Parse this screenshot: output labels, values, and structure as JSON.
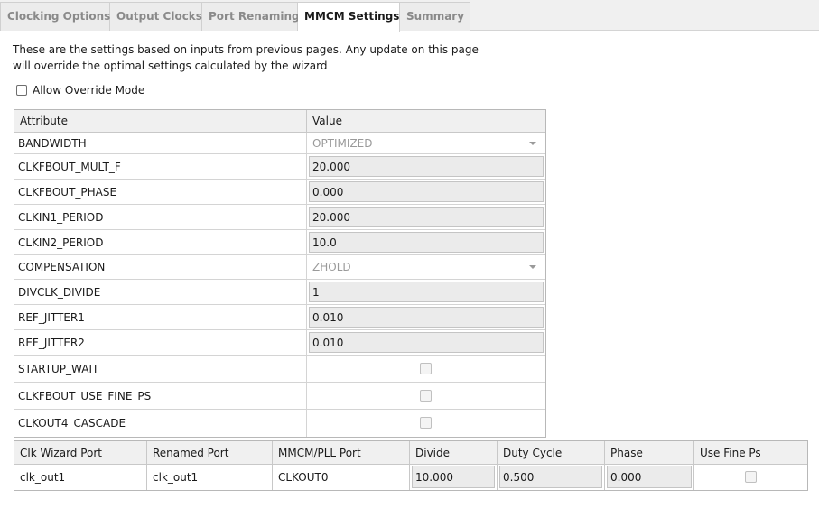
{
  "tabs": [
    {
      "label": "Clocking Options",
      "active": false
    },
    {
      "label": "Output Clocks",
      "active": false
    },
    {
      "label": "Port Renaming",
      "active": false
    },
    {
      "label": "MMCM Settings",
      "active": true
    },
    {
      "label": "Summary",
      "active": false
    }
  ],
  "description": {
    "line1": "These are the settings based on inputs from previous pages. Any update on this page",
    "line2": "will override the optimal settings calculated by the wizard"
  },
  "override": {
    "label": "Allow Override Mode",
    "checked": false
  },
  "attributes": {
    "header_attribute": "Attribute",
    "header_value": "Value",
    "rows": [
      {
        "name": "BANDWIDTH",
        "kind": "combo",
        "value": "OPTIMIZED"
      },
      {
        "name": "CLKFBOUT_MULT_F",
        "kind": "field",
        "value": "20.000"
      },
      {
        "name": "CLKFBOUT_PHASE",
        "kind": "field",
        "value": "0.000"
      },
      {
        "name": "CLKIN1_PERIOD",
        "kind": "field",
        "value": "20.000"
      },
      {
        "name": "CLKIN2_PERIOD",
        "kind": "field",
        "value": "10.0"
      },
      {
        "name": "COMPENSATION",
        "kind": "combo",
        "value": "ZHOLD"
      },
      {
        "name": "DIVCLK_DIVIDE",
        "kind": "field",
        "value": "1"
      },
      {
        "name": "REF_JITTER1",
        "kind": "field",
        "value": "0.010"
      },
      {
        "name": "REF_JITTER2",
        "kind": "field",
        "value": "0.010"
      },
      {
        "name": "STARTUP_WAIT",
        "kind": "checkbox",
        "value": false
      },
      {
        "name": "CLKFBOUT_USE_FINE_PS",
        "kind": "checkbox",
        "value": false
      },
      {
        "name": "CLKOUT4_CASCADE",
        "kind": "checkbox",
        "value": false
      }
    ]
  },
  "ports": {
    "headers": [
      "Clk Wizard Port",
      "Renamed Port",
      "MMCM/PLL Port",
      "Divide",
      "Duty Cycle",
      "Phase",
      "Use Fine Ps"
    ],
    "rows": [
      {
        "clk_wizard_port": "clk_out1",
        "renamed_port": "clk_out1",
        "mmcm_pll_port": "CLKOUT0",
        "divide": "10.000",
        "duty_cycle": "0.500",
        "phase": "0.000",
        "use_fine_ps": false
      }
    ]
  }
}
